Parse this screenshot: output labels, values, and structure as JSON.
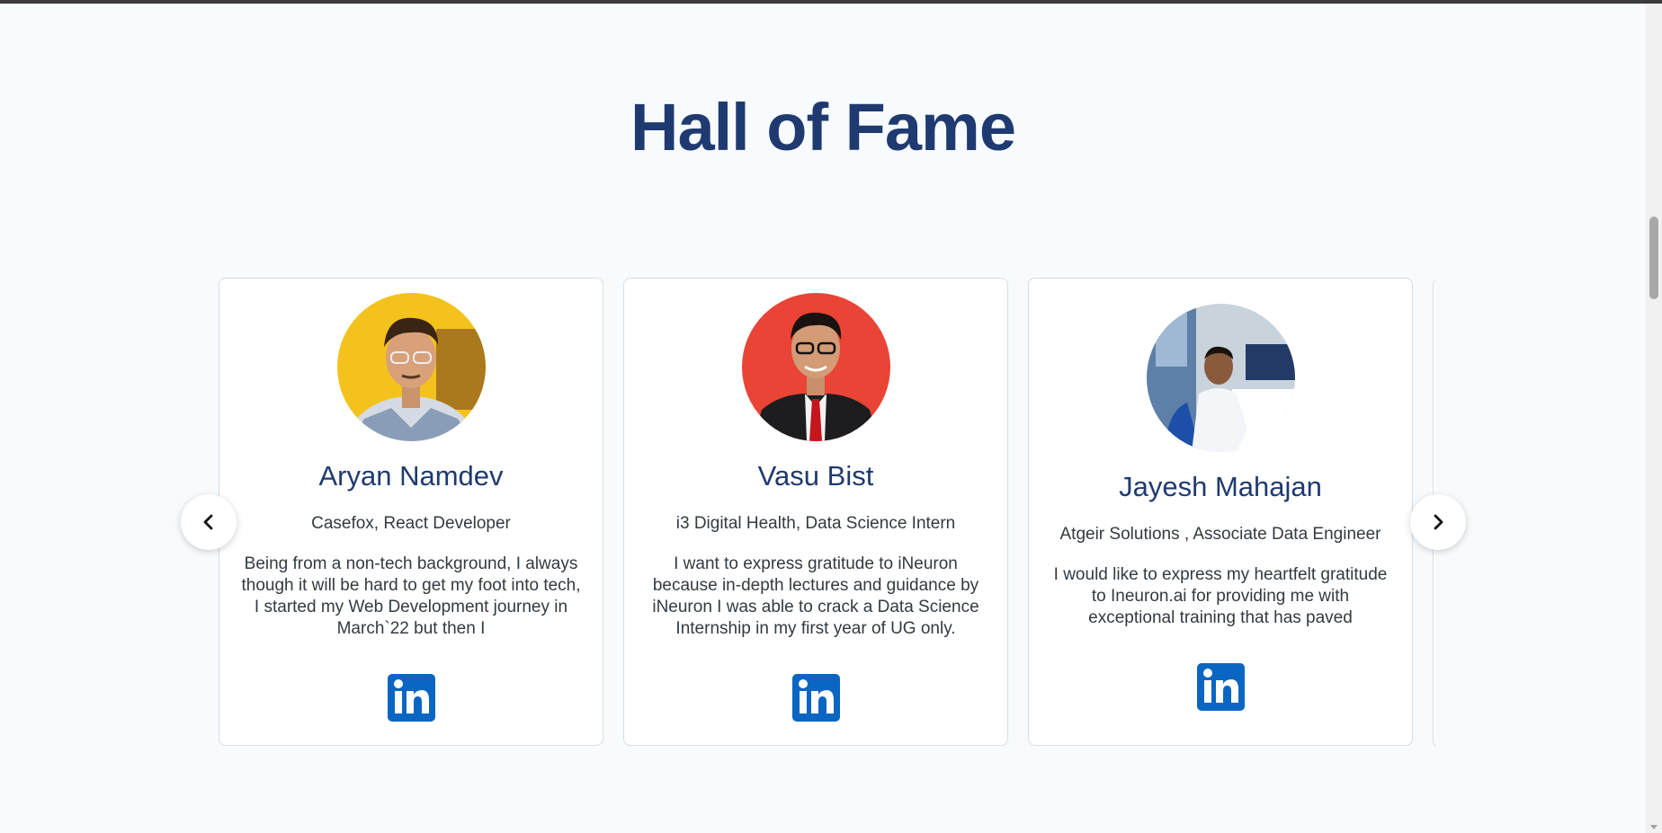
{
  "section": {
    "title": "Hall of Fame"
  },
  "cards": [
    {
      "name": "Aryan Namdev",
      "role": "Casefox, React Developer",
      "quote": "Being from a non-tech background, I always though it will be hard to get my foot into tech, I started my Web Development journey in March`22 but then I",
      "avatar_bg": "#f4c21c"
    },
    {
      "name": "Vasu Bist",
      "role": "i3 Digital Health, Data Science Intern",
      "quote": "I want to express gratitude to iNeuron because in-depth lectures and guidance by iNeuron I was able to crack a Data Science Internship in my first year of UG only.",
      "avatar_bg": "#e94435"
    },
    {
      "name": "Jayesh Mahajan",
      "role": "Atgeir Solutions , Associate Data Engineer",
      "quote": "I would like to express my heartfelt gratitude to Ineuron.ai for providing me with exceptional training that has paved",
      "avatar_bg": "#c9d3dc"
    }
  ],
  "icons": {
    "prev": "chevron-left-icon",
    "next": "chevron-right-icon",
    "social": "linkedin-icon"
  },
  "colors": {
    "heading": "#1f3a70",
    "linkedin": "#0a66c2",
    "background": "#f7fbfd"
  }
}
